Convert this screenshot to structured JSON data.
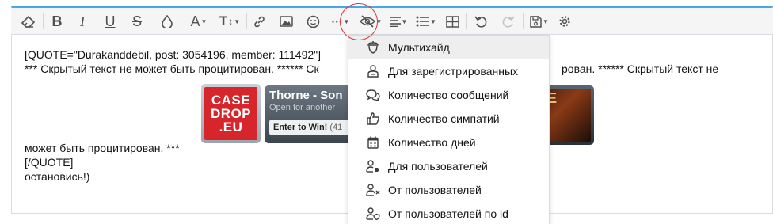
{
  "toolbar": {
    "buttons": [
      {
        "name": "remove-format-button"
      },
      {
        "name": "bold-button",
        "label": "B"
      },
      {
        "name": "italic-button",
        "label": "I"
      },
      {
        "name": "underline-button",
        "label": "U"
      },
      {
        "name": "strikethrough-button",
        "label": "S"
      },
      {
        "name": "text-color-button"
      },
      {
        "name": "font-family-button",
        "label": "A"
      },
      {
        "name": "font-size-button",
        "label": "T"
      },
      {
        "name": "link-button"
      },
      {
        "name": "image-button"
      },
      {
        "name": "smilies-button"
      },
      {
        "name": "more-options-button"
      },
      {
        "name": "hide-button"
      },
      {
        "name": "align-button"
      },
      {
        "name": "list-button"
      },
      {
        "name": "table-button"
      },
      {
        "name": "undo-button"
      },
      {
        "name": "redo-button"
      },
      {
        "name": "drafts-button"
      },
      {
        "name": "settings-button"
      }
    ]
  },
  "content": {
    "lines": [
      "[QUOTE=\"Durakanddebil, post: 3054196, member: 111492\"]",
      "*** Скрытый текст не может быть процитирован. ****** Ск",
      "рован. ****** Скрытый текст не",
      "может быть процитирован. ***",
      "[/QUOTE]",
      "остановись!)"
    ]
  },
  "banners": {
    "casedrop": {
      "line1": "CASE",
      "line2": "DROP",
      "line3": ".EU"
    },
    "thorne": {
      "title": "Thorne - Son",
      "subtitle": "Open for another",
      "button": "Enter to Win!",
      "count": "(41"
    },
    "game": {
      "text": "NE"
    }
  },
  "dropdown": {
    "items": [
      {
        "label": "Мультихайд",
        "icon": "acorn-icon"
      },
      {
        "label": "Для зарегистрированных",
        "icon": "user-badge-icon"
      },
      {
        "label": "Количество сообщений",
        "icon": "comments-icon"
      },
      {
        "label": "Количество симпатий",
        "icon": "thumbs-up-icon"
      },
      {
        "label": "Количество дней",
        "icon": "calendar-icon"
      },
      {
        "label": "Для пользователей",
        "icon": "user-tag-icon"
      },
      {
        "label": "От пользователей",
        "icon": "user-times-icon"
      },
      {
        "label": "От пользователей по id",
        "icon": "user-shield-icon"
      }
    ]
  },
  "colors": {
    "accent": "#47a7eb",
    "annotation": "#dd3333",
    "active_item_bg": "#eeeeee"
  }
}
